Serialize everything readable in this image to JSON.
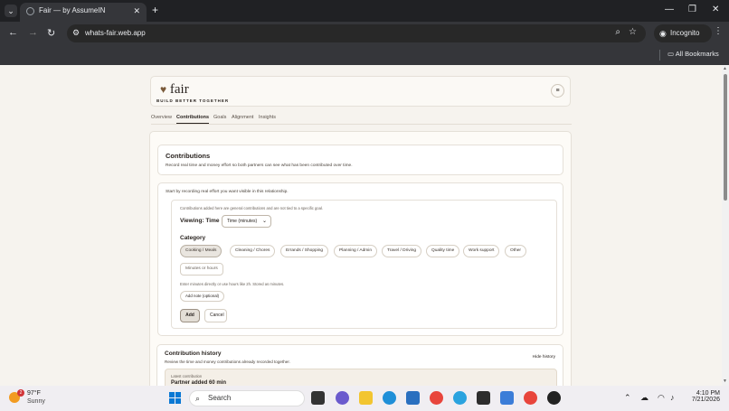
{
  "browser": {
    "tab_title": "Fair — by AssumeIN",
    "url": "whats-fair.web.app",
    "profile_label": "Incognito",
    "bookmarks_label": "All Bookmarks"
  },
  "app": {
    "logo_text": "fair",
    "tagline": "BUILD BETTER TOGETHER",
    "nav_tabs": [
      "Overview",
      "Contributions",
      "Goals",
      "Alignment",
      "Insights"
    ],
    "active_tab": "Contributions"
  },
  "contributions": {
    "title": "Contributions",
    "description": "Record real time and money effort so both partners can see what has been contributed over time.",
    "lead": "Start by recording real effort you want visible in this relationship.",
    "general_note": "Contributions added here are general contributions and are not tied to a specific goal.",
    "viewing_label": "Viewing: Time",
    "viewing_value": "Time (minutes)",
    "category_label": "Category",
    "categories": [
      "Cooking / Meals",
      "Cleaning / Chores",
      "Errands / Shopping",
      "Planning / Admin",
      "Travel / Driving",
      "Quality time",
      "Work support",
      "Other"
    ],
    "selected_category": "Cooking / Meals",
    "minutes_placeholder": "Minutes or hours",
    "minutes_hint": "Enter minutes directly or use hours like 2h. Stored as minutes.",
    "add_note_label": "Add note (optional)",
    "add_label": "Add",
    "cancel_label": "Cancel"
  },
  "history": {
    "title": "Contribution history",
    "description": "Review the time and money contributions already recorded together.",
    "hide_label": "Hide history",
    "latest_label": "Latest contribution",
    "latest_value": "Partner added 60 min"
  },
  "taskbar": {
    "temperature": "97°F",
    "condition": "Sunny",
    "weather_badge": "2",
    "search_label": "Search",
    "time": "4:10 PM",
    "date": "7/21/2026"
  },
  "colors": {
    "page_bg": "#f6f3ee",
    "card_bg": "#fdfbf7",
    "accent": "#7a5a3a",
    "chrome": "#202124"
  }
}
